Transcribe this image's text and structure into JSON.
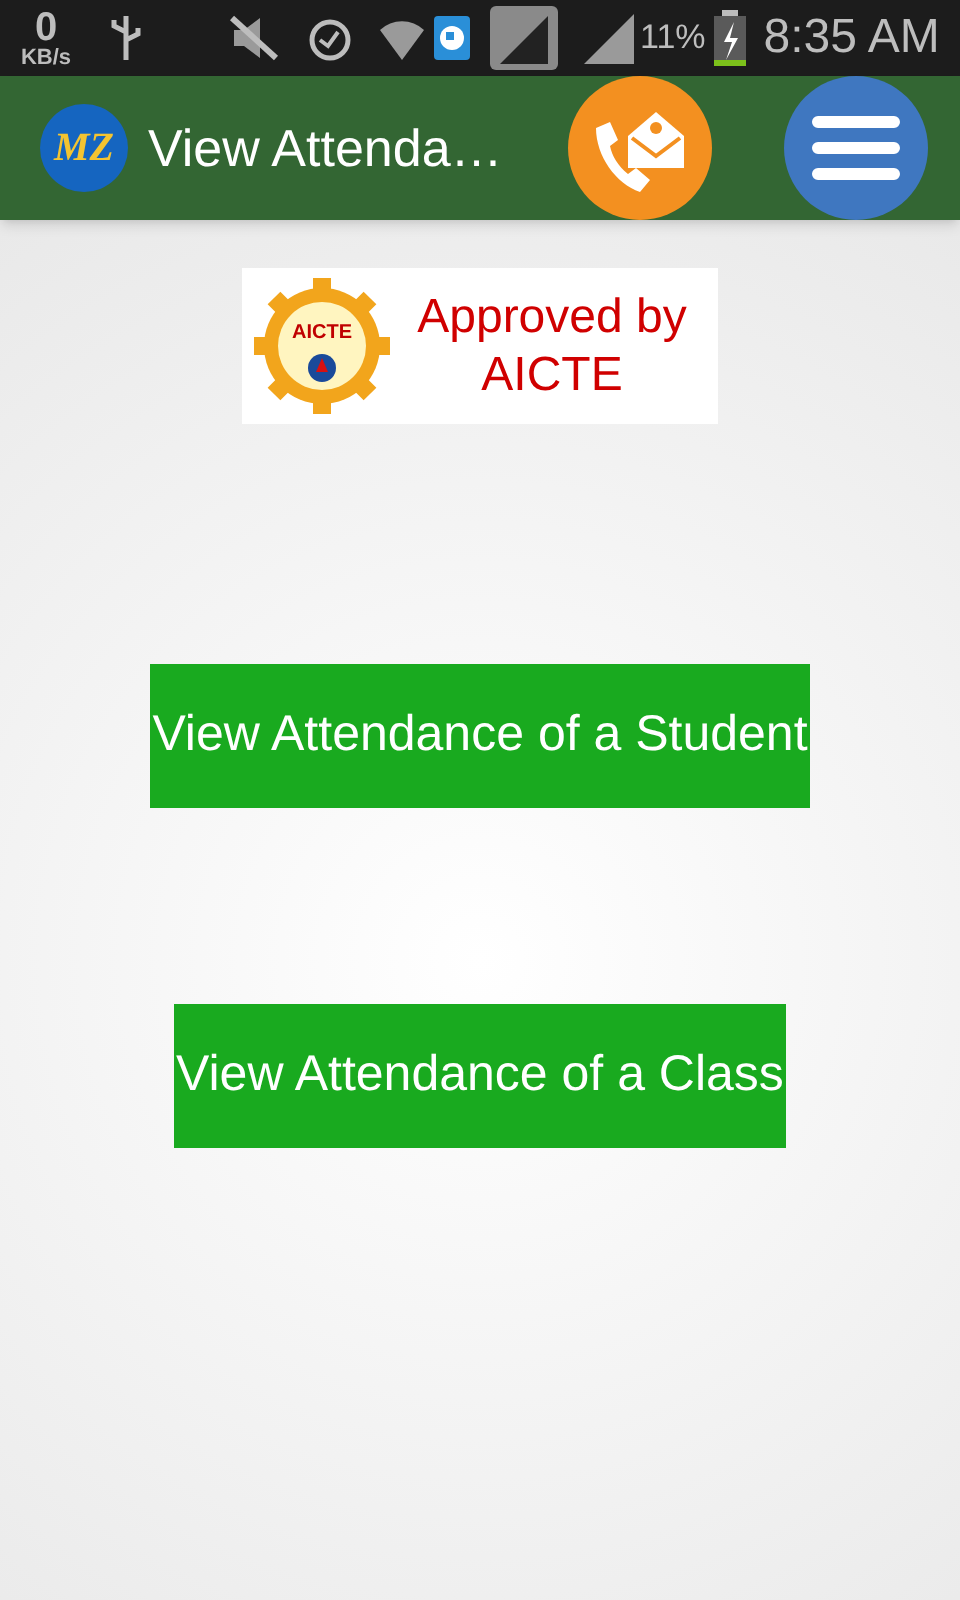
{
  "status_bar": {
    "speed": "0",
    "speed_unit": "KB/s",
    "battery": "11%",
    "time": "8:35 AM"
  },
  "app_bar": {
    "logo": "MZ",
    "title": "View Attenda…"
  },
  "banner": {
    "emblem": "AICTE",
    "text": "Approved by AICTE"
  },
  "buttons": [
    {
      "label": "View Attendance of a Student"
    },
    {
      "label": "View Attendance of a Class"
    }
  ]
}
